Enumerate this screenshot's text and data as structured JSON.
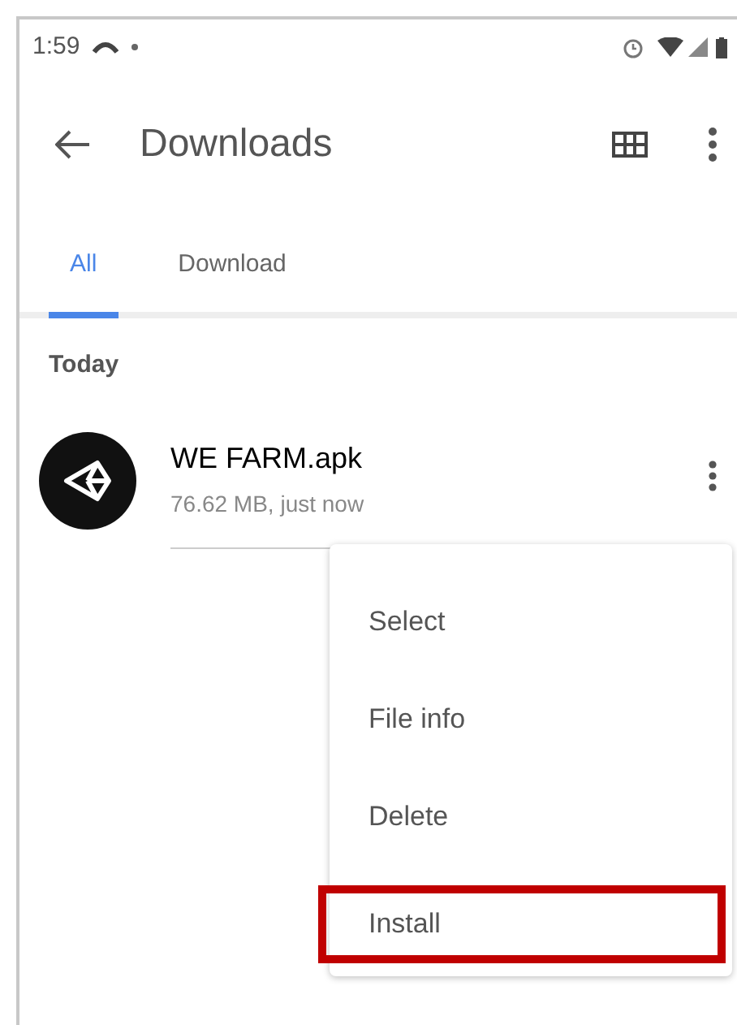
{
  "status_bar": {
    "time": "1:59"
  },
  "toolbar": {
    "title": "Downloads"
  },
  "tabs": [
    {
      "label": "All",
      "selected": true
    },
    {
      "label": "Download",
      "selected": false
    }
  ],
  "section": {
    "heading": "Today"
  },
  "files": [
    {
      "name": "WE FARM.apk",
      "meta": "76.62 MB, just now"
    }
  ],
  "menu": [
    {
      "label": "Select",
      "highlighted": false
    },
    {
      "label": "File info",
      "highlighted": false
    },
    {
      "label": "Delete",
      "highlighted": false
    },
    {
      "label": "Install",
      "highlighted": true
    }
  ]
}
